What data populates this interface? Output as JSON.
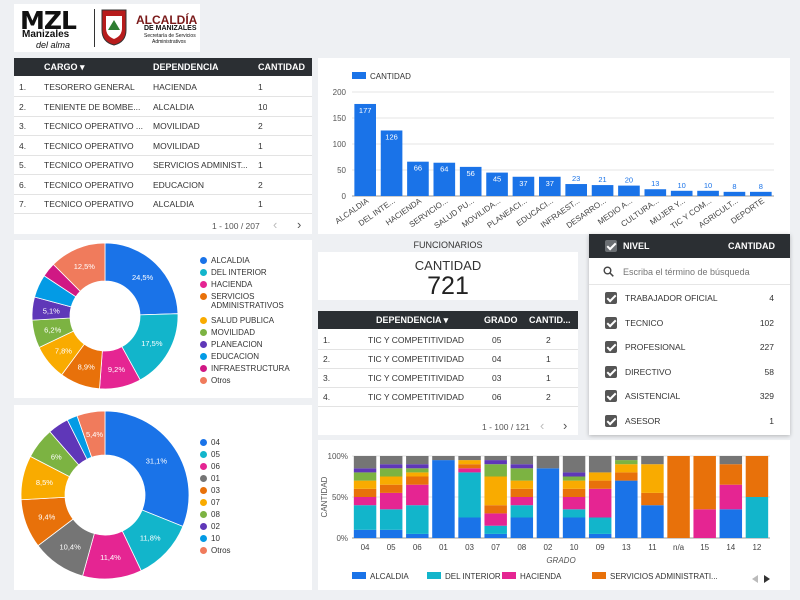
{
  "logo": {
    "brand": "MZL",
    "brand_sub": "Manizales",
    "brand_slogan": "del alma",
    "alcaldia_title": "ALCALDÍA",
    "alcaldia_sub": "DE MANIZALES",
    "alcaldia_dept1": "Secretaría de Servicios",
    "alcaldia_dept2": "Administrativos"
  },
  "cargo_table": {
    "headers": {
      "cargo": "CARGO ▾",
      "dependencia": "DEPENDENCIA",
      "cantidad": "CANTIDAD"
    },
    "rows": [
      {
        "n": "1.",
        "cargo": "TESORERO GENERAL",
        "dep": "HACIENDA",
        "cant": "1"
      },
      {
        "n": "2.",
        "cargo": "TENIENTE DE BOMBE...",
        "dep": "ALCALDIA",
        "cant": "10"
      },
      {
        "n": "3.",
        "cargo": "TECNICO OPERATIVO ...",
        "dep": "MOVILIDAD",
        "cant": "2"
      },
      {
        "n": "4.",
        "cargo": "TECNICO OPERATIVO",
        "dep": "MOVILIDAD",
        "cant": "1"
      },
      {
        "n": "5.",
        "cargo": "TECNICO OPERATIVO",
        "dep": "SERVICIOS ADMINIST...",
        "cant": "1"
      },
      {
        "n": "6.",
        "cargo": "TECNICO OPERATIVO",
        "dep": "EDUCACION",
        "cant": "2"
      },
      {
        "n": "7.",
        "cargo": "TECNICO OPERATIVO",
        "dep": "ALCALDIA",
        "cant": "1"
      }
    ],
    "pager": "1 - 100 / 207"
  },
  "score": {
    "title": "FUNCIONARIOS",
    "label": "CANTIDAD",
    "value": "721"
  },
  "dep_table": {
    "headers": {
      "dependencia": "DEPENDENCIA ▾",
      "grado": "GRADO",
      "cantidad": "CANTID..."
    },
    "rows": [
      {
        "n": "1.",
        "dep": "TIC Y COMPETITIVIDAD",
        "grado": "05",
        "cant": "2"
      },
      {
        "n": "2.",
        "dep": "TIC Y COMPETITIVIDAD",
        "grado": "04",
        "cant": "1"
      },
      {
        "n": "3.",
        "dep": "TIC Y COMPETITIVIDAD",
        "grado": "03",
        "cant": "1"
      },
      {
        "n": "4.",
        "dep": "TIC Y COMPETITIVIDAD",
        "grado": "06",
        "cant": "2"
      }
    ],
    "pager": "1 - 100 / 121"
  },
  "filter": {
    "title": "NIVEL",
    "count_header": "CANTIDAD",
    "search_placeholder": "Escriba el término de búsqueda",
    "items": [
      {
        "label": "TRABAJADOR OFICIAL",
        "value": "4"
      },
      {
        "label": "TECNICO",
        "value": "102"
      },
      {
        "label": "PROFESIONAL",
        "value": "227"
      },
      {
        "label": "DIRECTIVO",
        "value": "58"
      },
      {
        "label": "ASISTENCIAL",
        "value": "329"
      },
      {
        "label": "ASESOR",
        "value": "1"
      }
    ]
  },
  "chart_data": [
    {
      "type": "bar",
      "legend": [
        "CANTIDAD"
      ],
      "ylim": [
        0,
        200
      ],
      "yticks": [
        "0",
        "50",
        "100",
        "150",
        "200"
      ],
      "categories": [
        "ALCALDIA",
        "DEL INTE...",
        "HACIENDA",
        "SERVICIO...",
        "SALUD PU...",
        "MOVILIDA...",
        "PLANEACI...",
        "EDUCACI...",
        "INFRAEST...",
        "DESARRO...",
        "MEDIO A...",
        "CULTURA...",
        "MUJER Y...",
        "TIC Y COM...",
        "AGRICULT...",
        "DEPORTE"
      ],
      "values": [
        177,
        126,
        66,
        64,
        56,
        45,
        37,
        37,
        23,
        21,
        20,
        13,
        10,
        10,
        8,
        8
      ],
      "color": "#1a73e8"
    },
    {
      "type": "pie",
      "donut": true,
      "legend": [
        "ALCALDIA",
        "DEL INTERIOR",
        "HACIENDA",
        "SERVICIOS ADMINISTRATIVOS",
        "SALUD PUBLICA",
        "MOVILIDAD",
        "PLANEACION",
        "EDUCACION",
        "INFRAESTRUCTURA",
        "Otros"
      ],
      "legend_lines": [
        [
          "ALCALDIA"
        ],
        [
          "DEL INTERIOR"
        ],
        [
          "HACIENDA"
        ],
        [
          "SERVICIOS",
          "ADMINISTRATIVOS"
        ],
        [
          "SALUD PUBLICA"
        ],
        [
          "MOVILIDAD"
        ],
        [
          "PLANEACION"
        ],
        [
          "EDUCACION"
        ],
        [
          "INFRAESTRUCTURA"
        ],
        [
          "Otros"
        ]
      ],
      "values": [
        24.5,
        17.5,
        9.2,
        8.9,
        7.8,
        6.2,
        5.1,
        5.1,
        3.2,
        12.5
      ],
      "labels": [
        "24,5%",
        "17,5%",
        "9,2%",
        "8,9%",
        "7,8%",
        "6,2%",
        "5,1%",
        "",
        "",
        "12,5%"
      ],
      "colors": [
        "#1a73e8",
        "#12b5cb",
        "#e52592",
        "#e8710a",
        "#f9ab00",
        "#7cb342",
        "#5f37b8",
        "#039be5",
        "#d01884",
        "#f07b5c"
      ]
    },
    {
      "type": "pie",
      "donut": true,
      "legend": [
        "04",
        "05",
        "06",
        "01",
        "03",
        "07",
        "08",
        "02",
        "10",
        "Otros"
      ],
      "values": [
        31.1,
        11.8,
        11.4,
        10.4,
        9.4,
        8.5,
        6.0,
        4.0,
        2.0,
        5.4
      ],
      "labels": [
        "31,1%",
        "11,8%",
        "11,4%",
        "10,4%",
        "9,4%",
        "8,5%",
        "6%",
        "",
        "",
        "5,4%"
      ],
      "colors": [
        "#1a73e8",
        "#12b5cb",
        "#e52592",
        "#757575",
        "#e8710a",
        "#f9ab00",
        "#7cb342",
        "#5f37b8",
        "#039be5",
        "#f07b5c"
      ]
    },
    {
      "type": "bar",
      "stacked": "percent",
      "ylabel": "CANTIDAD",
      "xlabel": "GRADO",
      "yticks": [
        "0%",
        "50%",
        "100%"
      ],
      "categories": [
        "04",
        "05",
        "06",
        "01",
        "03",
        "07",
        "08",
        "02",
        "10",
        "09",
        "13",
        "11",
        "n/a",
        "15",
        "14",
        "12"
      ],
      "series": [
        {
          "name": "ALCALDIA",
          "color": "#1a73e8",
          "values": [
            10,
            10,
            5,
            95,
            25,
            5,
            25,
            85,
            25,
            5,
            70,
            40,
            0,
            0,
            35,
            0
          ]
        },
        {
          "name": "DEL INTERIOR",
          "color": "#12b5cb",
          "values": [
            30,
            25,
            35,
            0,
            55,
            10,
            15,
            0,
            10,
            20,
            0,
            0,
            0,
            0,
            0,
            50
          ]
        },
        {
          "name": "HACIENDA",
          "color": "#e52592",
          "values": [
            10,
            20,
            25,
            0,
            5,
            15,
            10,
            0,
            15,
            35,
            0,
            0,
            0,
            35,
            30,
            0
          ]
        },
        {
          "name": "SERVICIOS ADMINISTRATI...",
          "color": "#e8710a",
          "values": [
            10,
            10,
            10,
            0,
            5,
            10,
            10,
            0,
            10,
            10,
            10,
            15,
            100,
            65,
            25,
            50
          ]
        },
        {
          "name": "SALUD PUBLICA",
          "color": "#f9ab00",
          "values": [
            10,
            10,
            5,
            0,
            5,
            35,
            10,
            0,
            10,
            10,
            10,
            35,
            0,
            0,
            0,
            0
          ]
        },
        {
          "name": "MOVILIDAD",
          "color": "#7cb342",
          "values": [
            10,
            10,
            5,
            0,
            0,
            15,
            15,
            0,
            5,
            0,
            5,
            0,
            0,
            0,
            0,
            0
          ]
        },
        {
          "name": "PLANEACION",
          "color": "#5f37b8",
          "values": [
            5,
            5,
            5,
            0,
            0,
            5,
            5,
            0,
            5,
            0,
            0,
            0,
            0,
            0,
            0,
            0
          ]
        },
        {
          "name": "OTROS",
          "color": "#757575",
          "values": [
            15,
            10,
            10,
            5,
            5,
            5,
            10,
            15,
            20,
            20,
            5,
            10,
            0,
            0,
            10,
            0
          ]
        }
      ],
      "legend_visible": [
        "ALCALDIA",
        "DEL INTERIOR",
        "HACIENDA",
        "SERVICIOS ADMINISTRATI..."
      ]
    }
  ]
}
